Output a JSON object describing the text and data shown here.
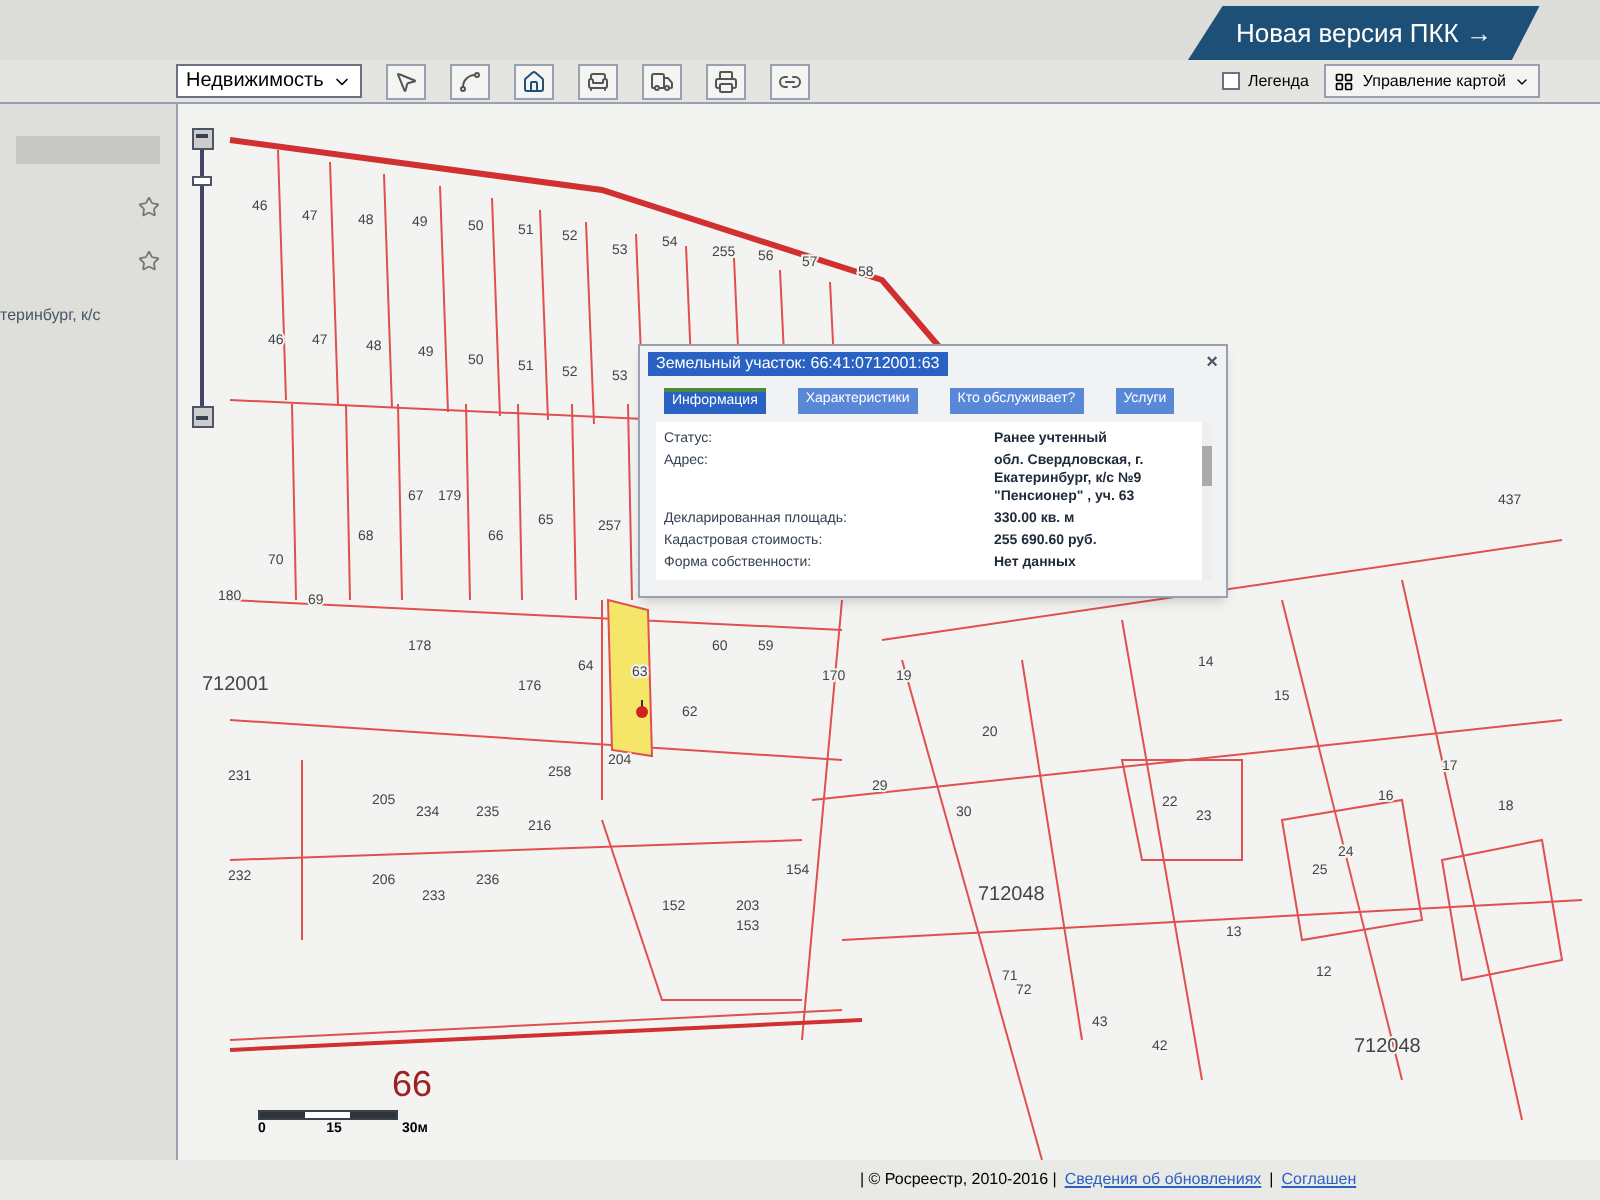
{
  "header": {
    "banner": "Новая версия ПКК →"
  },
  "toolbar": {
    "layer_select": "Недвижимость",
    "legend": {
      "label": "Легенда",
      "checked": false
    },
    "map_control": "Управление картой"
  },
  "sidebar": {
    "address_fragment": "теринбург, к/с"
  },
  "map": {
    "parcels": [
      "46",
      "47",
      "48",
      "49",
      "50",
      "51",
      "52",
      "53",
      "54",
      "255",
      "56",
      "57",
      "58",
      "46",
      "47",
      "48",
      "49",
      "50",
      "51",
      "52",
      "53",
      "180",
      "70",
      "69",
      "68",
      "67",
      "179",
      "66",
      "65",
      "257",
      "178",
      "176",
      "64",
      "63",
      "62",
      "60",
      "59",
      "170",
      "19",
      "20",
      "29",
      "30",
      "231",
      "205",
      "234",
      "235",
      "216",
      "258",
      "204",
      "232",
      "206",
      "233",
      "236",
      "152",
      "203",
      "153",
      "154",
      "71",
      "72",
      "42",
      "43",
      "22",
      "23",
      "25",
      "24",
      "14",
      "15",
      "17",
      "18",
      "16",
      "13",
      "12",
      "437"
    ],
    "blocks": [
      "712001",
      "712048",
      "712048"
    ],
    "district": "66",
    "zoom": {
      "level": 0.9
    },
    "scale": {
      "ticks": [
        "0",
        "15",
        "30м"
      ]
    }
  },
  "popup": {
    "title": "Земельный участок: 66:41:0712001:63",
    "close": "×",
    "tabs": [
      {
        "label": "Информация",
        "selected": true
      },
      {
        "label": "Характеристики",
        "selected": false
      },
      {
        "label": "Кто обслуживает?",
        "selected": false
      },
      {
        "label": "Услуги",
        "selected": false
      }
    ],
    "rows": [
      {
        "label": "Статус:",
        "value": "Ранее учтенный"
      },
      {
        "label": "Адрес:",
        "value": "обл. Свердловская, г. Екатеринбург, к/с №9 \"Пенсионер\" , уч. 63"
      },
      {
        "label": "Декларированная площадь:",
        "value": "330.00 кв. м"
      },
      {
        "label": "Кадастровая стоимость:",
        "value": "255 690.60 руб."
      },
      {
        "label": "Форма собственности:",
        "value": "Нет данных"
      }
    ]
  },
  "footer": {
    "copyright": "| © Росреестр, 2010-2016 |",
    "links": [
      "Сведения об обновлениях",
      "Соглашен"
    ],
    "separator": "|"
  }
}
